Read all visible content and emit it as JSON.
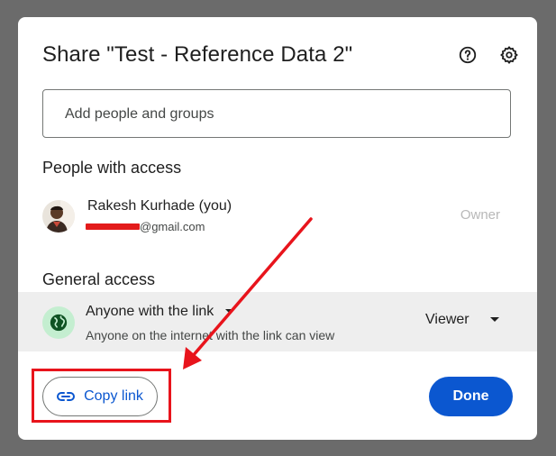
{
  "dialog": {
    "title": "Share \"Test - Reference Data 2\"",
    "help_icon": "help-circle-icon",
    "settings_icon": "gear-icon"
  },
  "add_people": {
    "placeholder": "Add people and groups"
  },
  "people_with_access": {
    "heading": "People with access",
    "people": [
      {
        "name": "Rakesh Kurhade (you)",
        "email_suffix": "@gmail.com",
        "role": "Owner"
      }
    ]
  },
  "general_access": {
    "heading": "General access",
    "scope": "Anyone with the link",
    "description": "Anyone on the internet with the link can view",
    "role": "Viewer",
    "icon": "globe-icon"
  },
  "footer": {
    "copy_link_label": "Copy link",
    "done_label": "Done"
  },
  "colors": {
    "accent": "#0b57d0",
    "annotation": "#e8141c",
    "globe_bg": "#c4eed0"
  }
}
